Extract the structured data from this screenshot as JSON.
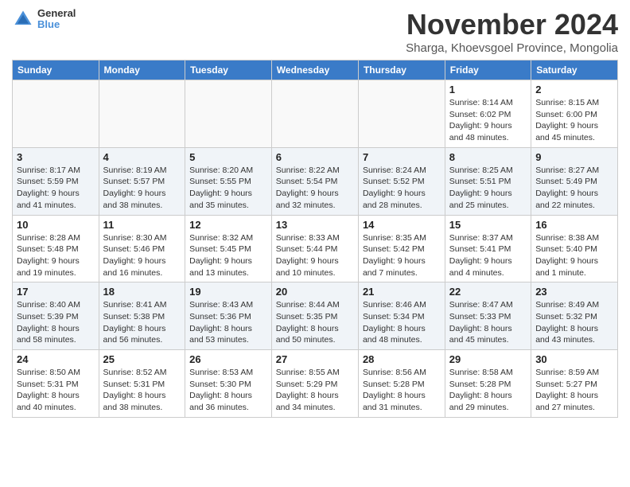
{
  "logo": {
    "general": "General",
    "blue": "Blue"
  },
  "title": "November 2024",
  "subtitle": "Sharga, Khoevsgoel Province, Mongolia",
  "days": [
    "Sunday",
    "Monday",
    "Tuesday",
    "Wednesday",
    "Thursday",
    "Friday",
    "Saturday"
  ],
  "weeks": [
    [
      {
        "day": "",
        "info": ""
      },
      {
        "day": "",
        "info": ""
      },
      {
        "day": "",
        "info": ""
      },
      {
        "day": "",
        "info": ""
      },
      {
        "day": "",
        "info": ""
      },
      {
        "day": "1",
        "info": "Sunrise: 8:14 AM\nSunset: 6:02 PM\nDaylight: 9 hours and 48 minutes."
      },
      {
        "day": "2",
        "info": "Sunrise: 8:15 AM\nSunset: 6:00 PM\nDaylight: 9 hours and 45 minutes."
      }
    ],
    [
      {
        "day": "3",
        "info": "Sunrise: 8:17 AM\nSunset: 5:59 PM\nDaylight: 9 hours and 41 minutes."
      },
      {
        "day": "4",
        "info": "Sunrise: 8:19 AM\nSunset: 5:57 PM\nDaylight: 9 hours and 38 minutes."
      },
      {
        "day": "5",
        "info": "Sunrise: 8:20 AM\nSunset: 5:55 PM\nDaylight: 9 hours and 35 minutes."
      },
      {
        "day": "6",
        "info": "Sunrise: 8:22 AM\nSunset: 5:54 PM\nDaylight: 9 hours and 32 minutes."
      },
      {
        "day": "7",
        "info": "Sunrise: 8:24 AM\nSunset: 5:52 PM\nDaylight: 9 hours and 28 minutes."
      },
      {
        "day": "8",
        "info": "Sunrise: 8:25 AM\nSunset: 5:51 PM\nDaylight: 9 hours and 25 minutes."
      },
      {
        "day": "9",
        "info": "Sunrise: 8:27 AM\nSunset: 5:49 PM\nDaylight: 9 hours and 22 minutes."
      }
    ],
    [
      {
        "day": "10",
        "info": "Sunrise: 8:28 AM\nSunset: 5:48 PM\nDaylight: 9 hours and 19 minutes."
      },
      {
        "day": "11",
        "info": "Sunrise: 8:30 AM\nSunset: 5:46 PM\nDaylight: 9 hours and 16 minutes."
      },
      {
        "day": "12",
        "info": "Sunrise: 8:32 AM\nSunset: 5:45 PM\nDaylight: 9 hours and 13 minutes."
      },
      {
        "day": "13",
        "info": "Sunrise: 8:33 AM\nSunset: 5:44 PM\nDaylight: 9 hours and 10 minutes."
      },
      {
        "day": "14",
        "info": "Sunrise: 8:35 AM\nSunset: 5:42 PM\nDaylight: 9 hours and 7 minutes."
      },
      {
        "day": "15",
        "info": "Sunrise: 8:37 AM\nSunset: 5:41 PM\nDaylight: 9 hours and 4 minutes."
      },
      {
        "day": "16",
        "info": "Sunrise: 8:38 AM\nSunset: 5:40 PM\nDaylight: 9 hours and 1 minute."
      }
    ],
    [
      {
        "day": "17",
        "info": "Sunrise: 8:40 AM\nSunset: 5:39 PM\nDaylight: 8 hours and 58 minutes."
      },
      {
        "day": "18",
        "info": "Sunrise: 8:41 AM\nSunset: 5:38 PM\nDaylight: 8 hours and 56 minutes."
      },
      {
        "day": "19",
        "info": "Sunrise: 8:43 AM\nSunset: 5:36 PM\nDaylight: 8 hours and 53 minutes."
      },
      {
        "day": "20",
        "info": "Sunrise: 8:44 AM\nSunset: 5:35 PM\nDaylight: 8 hours and 50 minutes."
      },
      {
        "day": "21",
        "info": "Sunrise: 8:46 AM\nSunset: 5:34 PM\nDaylight: 8 hours and 48 minutes."
      },
      {
        "day": "22",
        "info": "Sunrise: 8:47 AM\nSunset: 5:33 PM\nDaylight: 8 hours and 45 minutes."
      },
      {
        "day": "23",
        "info": "Sunrise: 8:49 AM\nSunset: 5:32 PM\nDaylight: 8 hours and 43 minutes."
      }
    ],
    [
      {
        "day": "24",
        "info": "Sunrise: 8:50 AM\nSunset: 5:31 PM\nDaylight: 8 hours and 40 minutes."
      },
      {
        "day": "25",
        "info": "Sunrise: 8:52 AM\nSunset: 5:31 PM\nDaylight: 8 hours and 38 minutes."
      },
      {
        "day": "26",
        "info": "Sunrise: 8:53 AM\nSunset: 5:30 PM\nDaylight: 8 hours and 36 minutes."
      },
      {
        "day": "27",
        "info": "Sunrise: 8:55 AM\nSunset: 5:29 PM\nDaylight: 8 hours and 34 minutes."
      },
      {
        "day": "28",
        "info": "Sunrise: 8:56 AM\nSunset: 5:28 PM\nDaylight: 8 hours and 31 minutes."
      },
      {
        "day": "29",
        "info": "Sunrise: 8:58 AM\nSunset: 5:28 PM\nDaylight: 8 hours and 29 minutes."
      },
      {
        "day": "30",
        "info": "Sunrise: 8:59 AM\nSunset: 5:27 PM\nDaylight: 8 hours and 27 minutes."
      }
    ]
  ]
}
